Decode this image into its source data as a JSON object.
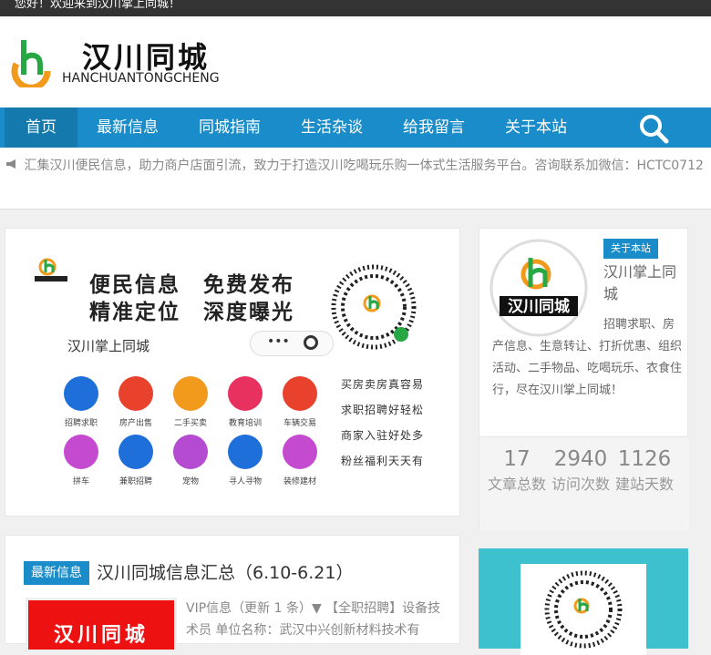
{
  "topbar": {
    "welcome": "您好！欢迎来到汉川掌上同城！"
  },
  "header": {
    "logo_cn": "汉川同城",
    "logo_en": "HANCHUANTONGCHENG"
  },
  "nav": {
    "items": [
      {
        "label": "首页",
        "active": true
      },
      {
        "label": "最新信息",
        "active": false
      },
      {
        "label": "同城指南",
        "active": false
      },
      {
        "label": "生活杂谈",
        "active": false
      },
      {
        "label": "给我留言",
        "active": false
      },
      {
        "label": "关于本站",
        "active": false
      }
    ],
    "search_icon": "search-icon"
  },
  "notice": {
    "icon": "megaphone-icon",
    "text": "汇集汉川便民信息，助力商户店面引流，致力于打造汉川吃喝玩乐购一体式生活服务平台。咨询联系加微信：HCTC0712"
  },
  "banner": {
    "slogan_line1": "便民信息　免费发布",
    "slogan_line2": "精准定位　深度曝光",
    "mini_app_label": "汉川掌上同城",
    "services": [
      {
        "label": "招聘求职",
        "color": "#1e6fd9"
      },
      {
        "label": "房产出售",
        "color": "#e8412c"
      },
      {
        "label": "二手买卖",
        "color": "#f29a1c"
      },
      {
        "label": "教育培训",
        "color": "#e8315f"
      },
      {
        "label": "车辆交易",
        "color": "#e8412c"
      },
      {
        "label": "拼车",
        "color": "#c44bd0"
      },
      {
        "label": "兼职招聘",
        "color": "#1e6fd9"
      },
      {
        "label": "宠物",
        "color": "#b44bd0"
      },
      {
        "label": "寻人寻物",
        "color": "#1e6fd9"
      },
      {
        "label": "装修建材",
        "color": "#c44bd0"
      }
    ],
    "side_lines": [
      "买房卖房真容易",
      "求职招聘好轻松",
      "商家入驻好处多",
      "粉丝福利天天有"
    ]
  },
  "about": {
    "tag": "关于本站",
    "title": "汉川掌上同城",
    "desc": "招聘求职、房产信息、生意转让、打折优惠、组织活动、二手物品、吃喝玩乐、衣食住行，尽在汉川掌上同城！",
    "stats": [
      {
        "num": "17",
        "label": "文章总数"
      },
      {
        "num": "2940",
        "label": "访问次数"
      },
      {
        "num": "1126",
        "label": "建站天数"
      }
    ]
  },
  "post": {
    "tag": "最新信息",
    "title": "汉川同城信息汇总（6.10-6.21）",
    "thumb_text": "汉川同城",
    "excerpt": "VIP信息（更新 1 条）▼ 【全职招聘】设备技术员 单位名称：武汉中兴创新材料技术有"
  },
  "colors": {
    "nav": "#1a8cc9",
    "accent_orange": "#f29a1c",
    "accent_green": "#27a844"
  }
}
